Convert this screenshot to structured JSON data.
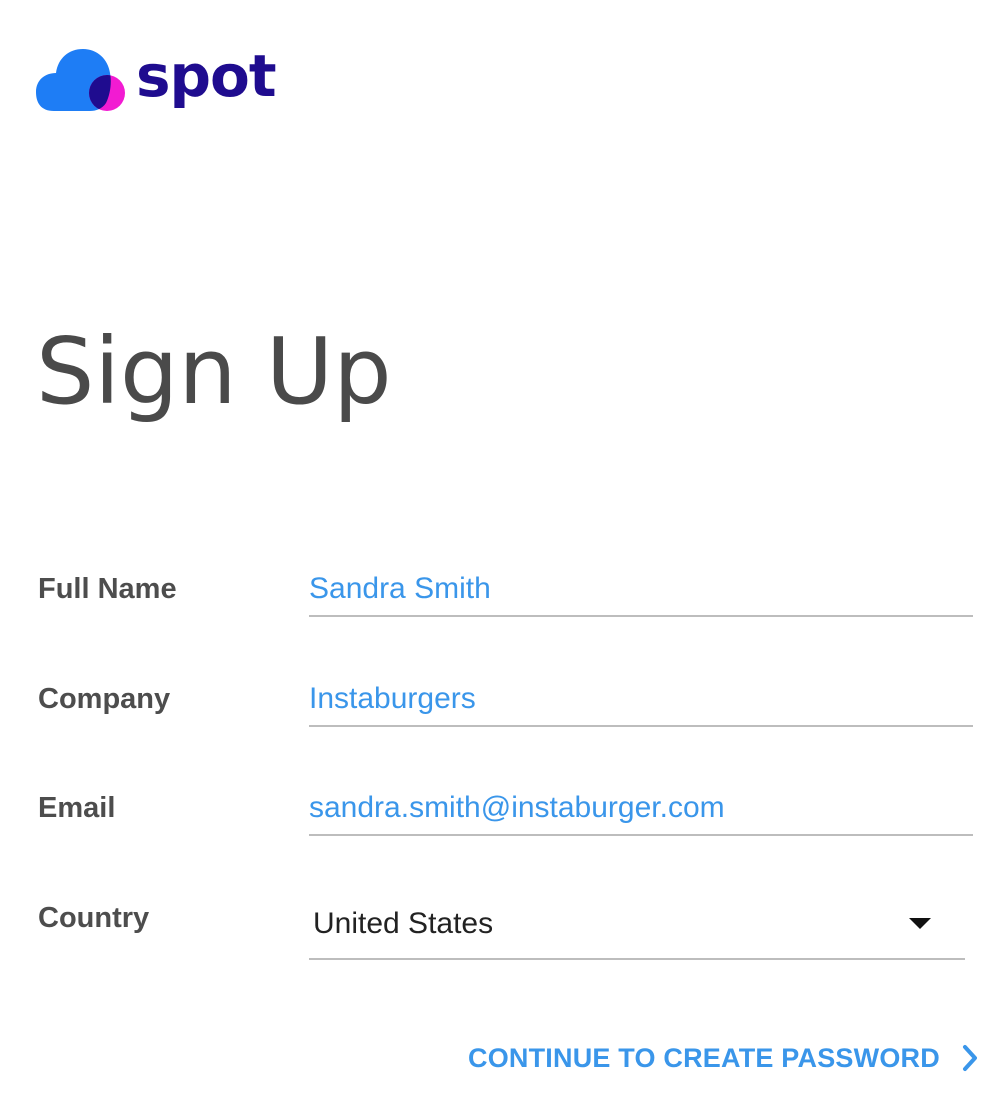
{
  "brand": {
    "name": "spot",
    "colors": {
      "cloud": "#1e7df5",
      "circle": "#f21bd2",
      "overlap": "#1f0c8f",
      "text": "#1f0c8f"
    }
  },
  "page": {
    "title": "Sign Up"
  },
  "form": {
    "fields": [
      {
        "label": "Full Name",
        "value": "Sandra Smith",
        "type": "text"
      },
      {
        "label": "Company",
        "value": "Instaburgers",
        "type": "text"
      },
      {
        "label": "Email",
        "value": "sandra.smith@instaburger.com",
        "type": "email"
      }
    ],
    "country": {
      "label": "Country",
      "selected": "United States"
    }
  },
  "actions": {
    "continue_label": "CONTINUE TO CREATE PASSWORD",
    "continue_icon": "chevron-right-icon"
  },
  "theme": {
    "accent": "#3a96ea",
    "label_color": "#4d4d4d",
    "title_color": "#4a4a4a",
    "underline": "#bdbdbd"
  }
}
